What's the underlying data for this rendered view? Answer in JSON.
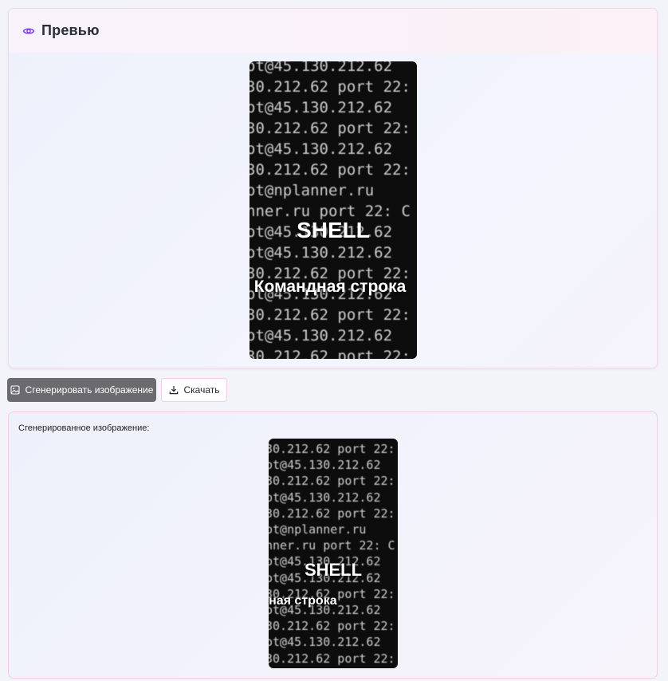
{
  "preview": {
    "title": "Превью",
    "icon": "eye-icon"
  },
  "image": {
    "heading": "SHELL",
    "subheading": "Командная строка",
    "terminal_lines": [
      "ot@45.130.212.62",
      "30.212.62 port 22:",
      "ot@45.130.212.62",
      "30.212.62 port 22:",
      "ot@45.130.212.62",
      "30.212.62 port 22:",
      "ot@nplanner.ru",
      "nner.ru port 22: C",
      "ot@45.130.212.62",
      "ot@45.130.212.62",
      "30.212.62 port 22:",
      "ot@45.130.212.62",
      "30.212.62 port 22:",
      "ot@45.130.212.62",
      "30.212.62 port 22:"
    ]
  },
  "actions": {
    "generate_label": "Сгенерировать изображение",
    "generate_icon": "image-icon",
    "download_label": "Скачать",
    "download_icon": "download-icon"
  },
  "generated": {
    "label": "Сгенерированное изображение:"
  },
  "colors": {
    "accent": "#7c3aed",
    "button_dark": "#6b6b6f"
  }
}
